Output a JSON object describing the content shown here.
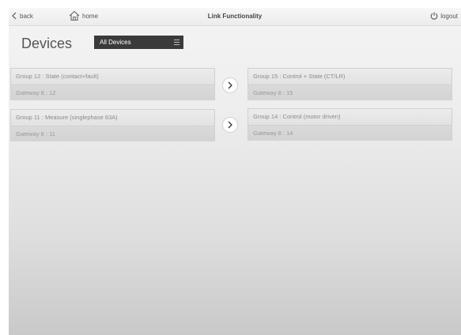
{
  "topbar": {
    "back_label": "back",
    "home_label": "home",
    "title": "Link Functionality",
    "logout_label": "logout"
  },
  "page": {
    "heading": "Devices",
    "filter_value": "All Devices"
  },
  "links": [
    {
      "source": {
        "group": "Group 12 : State (contact+fault)",
        "gateway": "Gateway 8 : 12"
      },
      "target": {
        "group": "Group 15 : Control + State (CT/LR)",
        "gateway": "Gateway 8 : 15"
      }
    },
    {
      "source": {
        "group": "Group 11 : Measure (singlephase 63A)",
        "gateway": "Gateway 8 : 11"
      },
      "target": {
        "group": "Group 14 : Control (motor driven)",
        "gateway": "Gateway 8 : 14"
      }
    }
  ],
  "colors": {
    "filter_bg": "#3a3a3a",
    "card_bg": "#e3e3e3",
    "text": "#555555"
  },
  "icons": [
    "chevron-left-icon",
    "home-icon",
    "power-icon",
    "menu-icon",
    "chevron-right-icon"
  ]
}
